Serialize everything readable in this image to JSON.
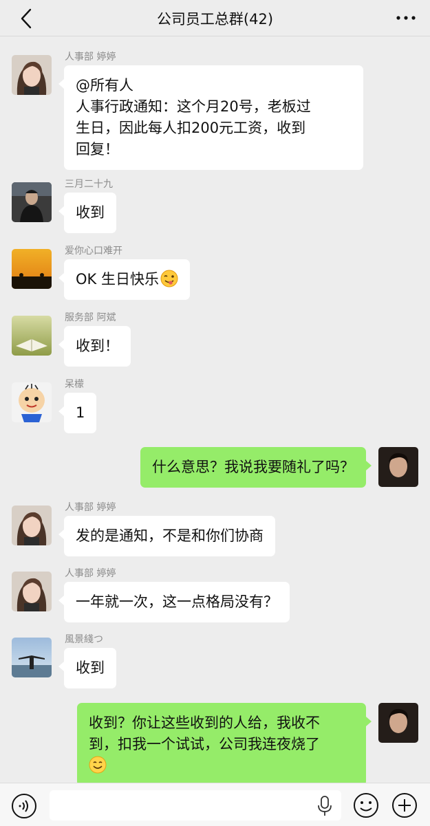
{
  "header": {
    "title": "公司员工总群(42)",
    "back_icon": "chevron-left-icon",
    "more_icon": "more-dots-icon"
  },
  "messages": [
    {
      "side": "left",
      "sender": "人事部 婷婷",
      "text": "@所有人\n人事行政通知：这个月20号，老板过\n生日，因此每人扣200元工资，收到\n回复！",
      "avatar": "avatar-tingting"
    },
    {
      "side": "left",
      "sender": "三月二十九",
      "text": "收到",
      "avatar": "avatar-sanyue"
    },
    {
      "side": "left",
      "sender": "爱你心口难开",
      "text": "OK 生日快乐",
      "emoji": "wink-tongue-emoji",
      "avatar": "avatar-sunset"
    },
    {
      "side": "left",
      "sender": "服务部 阿斌",
      "text": "收到！",
      "avatar": "avatar-book"
    },
    {
      "side": "left",
      "sender": "呆檬",
      "text": "1",
      "avatar": "avatar-cartoon"
    },
    {
      "side": "right",
      "text": "什么意思？我说我要随礼了吗？",
      "avatar": "avatar-me"
    },
    {
      "side": "left",
      "sender": "人事部 婷婷",
      "text": "发的是通知，不是和你们协商",
      "avatar": "avatar-tingting"
    },
    {
      "side": "left",
      "sender": "人事部 婷婷",
      "text": "一年就一次，这一点格局没有？",
      "avatar": "avatar-tingting"
    },
    {
      "side": "left",
      "sender": "風景綫つ",
      "text": "收到",
      "avatar": "avatar-scenery"
    },
    {
      "side": "right",
      "text": "收到？你让这些收到的人给，我收不\n到，扣我一个试试，公司我连夜烧了",
      "emoji": "smile-emoji",
      "avatar": "avatar-me"
    }
  ],
  "input_bar": {
    "placeholder": "",
    "voice_icon": "voice-icon",
    "mic_icon": "microphone-icon",
    "emoji_icon": "emoji-icon",
    "plus_icon": "plus-icon"
  },
  "colors": {
    "background": "#ededed",
    "bubble_self": "#95ec69",
    "bubble_other": "#ffffff",
    "sender_name": "#8c8c8c"
  }
}
